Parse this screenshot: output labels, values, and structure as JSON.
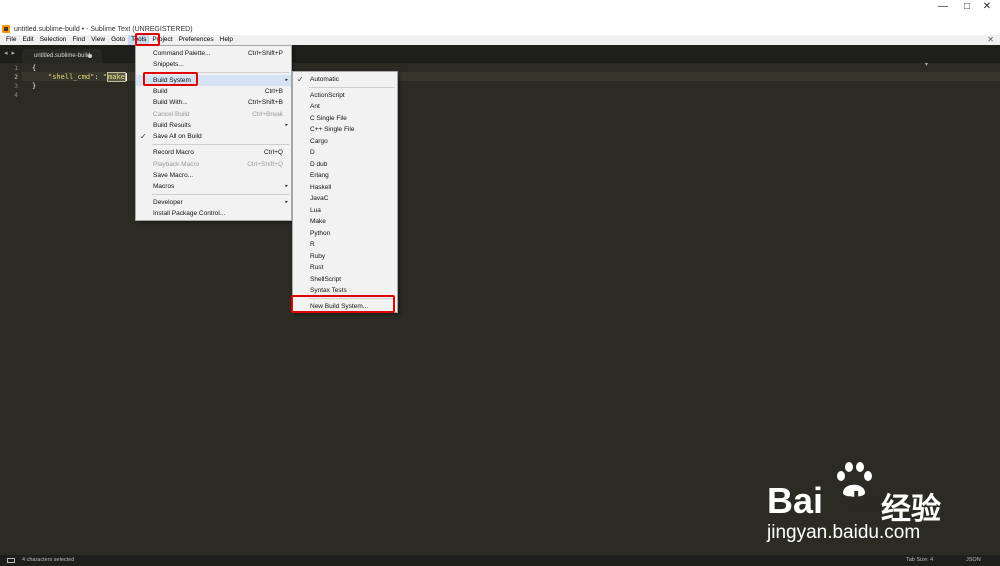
{
  "window": {
    "title": "untitled.sublime-build • - Sublime Text (UNREGISTERED)",
    "controls": {
      "minimize": "—",
      "maximize": "□",
      "close": "✕"
    }
  },
  "menubar": {
    "items": [
      "File",
      "Edit",
      "Selection",
      "Find",
      "View",
      "Goto",
      "Tools",
      "Project",
      "Preferences",
      "Help"
    ],
    "active": "Tools",
    "close_glyph": "✕"
  },
  "tabs": [
    {
      "label": "untitled.sublime-build",
      "modified": true
    }
  ],
  "nav_arrows": "◂ ▸",
  "tab_dropdown": "▾",
  "editor": {
    "line_numbers": [
      "1",
      "2",
      "3",
      "4"
    ],
    "lines": {
      "l1": "{",
      "l2_key": "\"shell_cmd\"",
      "l2_colon": ": ",
      "l2_quote": "\"",
      "l2_selected": "make",
      "l3": "}"
    }
  },
  "tools_menu": {
    "items": [
      {
        "label": "Command Palette...",
        "shortcut": "Ctrl+Shift+P"
      },
      {
        "label": "Snippets...",
        "shortcut": ""
      },
      {
        "label": "Build System",
        "shortcut": "",
        "submenu": true
      },
      {
        "label": "Build",
        "shortcut": "Ctrl+B"
      },
      {
        "label": "Build With...",
        "shortcut": "Ctrl+Shift+B"
      },
      {
        "label": "Cancel Build",
        "shortcut": "Ctrl+Break",
        "disabled": true
      },
      {
        "label": "Build Results",
        "shortcut": "",
        "submenu": true
      },
      {
        "label": "Save All on Build",
        "shortcut": "",
        "checked": true
      },
      {
        "label": "Record Macro",
        "shortcut": "Ctrl+Q"
      },
      {
        "label": "Playback Macro",
        "shortcut": "Ctrl+Shift+Q",
        "disabled": true
      },
      {
        "label": "Save Macro...",
        "shortcut": "",
        "disabled": false
      },
      {
        "label": "Macros",
        "shortcut": "",
        "submenu": true
      },
      {
        "label": "Developer",
        "shortcut": "",
        "submenu": true
      },
      {
        "label": "Install Package Control...",
        "shortcut": ""
      }
    ]
  },
  "build_system_menu": {
    "items": [
      "Automatic",
      "ActionScript",
      "Ant",
      "C Single File",
      "C++ Single File",
      "Cargo",
      "D",
      "D dub",
      "Erlang",
      "Haskell",
      "JavaC",
      "Lua",
      "Make",
      "Python",
      "R",
      "Ruby",
      "Rust",
      "ShellScript",
      "Syntax Tests",
      "New Build System..."
    ],
    "checked": "Automatic"
  },
  "glyphs": {
    "check": "✓",
    "submenu_arrow": "▸"
  },
  "statusbar": {
    "selection": "4 characters selected",
    "tab_size": "Tab Size: 4",
    "syntax": "JSON"
  },
  "watermark": {
    "brand_a": "Bai",
    "brand_b": "du",
    "brand_cn": "经验",
    "url": "jingyan.baidu.com"
  },
  "colors": {
    "editor_bg": "#2b2b24",
    "accent_red": "#e00000",
    "menu_bg": "#f2f2f2"
  }
}
